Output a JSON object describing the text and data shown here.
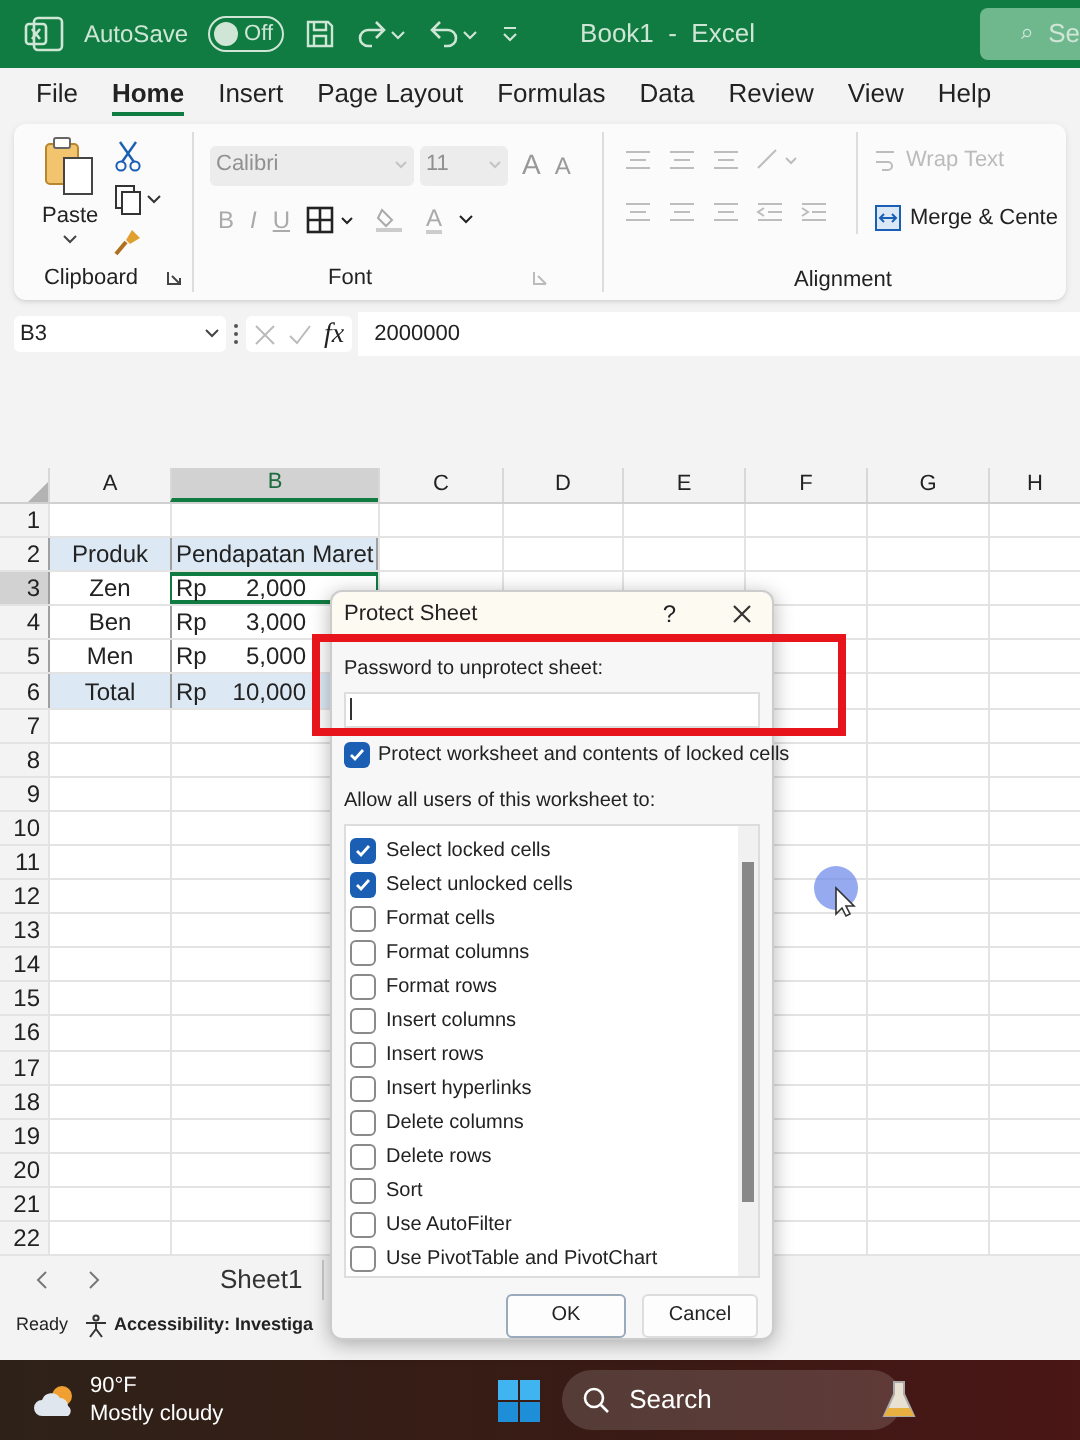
{
  "title_bar": {
    "autosave_label": "AutoSave",
    "autosave": {
      "on": false,
      "label": "Off"
    },
    "title": "Book1  -  Excel",
    "search_text": "Se"
  },
  "menu_tabs": [
    {
      "label": "File",
      "selected": false
    },
    {
      "label": "Home",
      "selected": true
    },
    {
      "label": "Insert",
      "selected": false
    },
    {
      "label": "Page Layout",
      "selected": false
    },
    {
      "label": "Formulas",
      "selected": false
    },
    {
      "label": "Data",
      "selected": false
    },
    {
      "label": "Review",
      "selected": false
    },
    {
      "label": "View",
      "selected": false
    },
    {
      "label": "Help",
      "selected": false
    }
  ],
  "ribbon": {
    "clipboard": {
      "paste_label": "Paste",
      "group_label": "Clipboard"
    },
    "font": {
      "font_name": "Calibri",
      "font_size": "11",
      "grow": "A",
      "shrink": "A",
      "bold": "B",
      "italic": "I",
      "underline": "U",
      "color_letter": "A",
      "group_label": "Font"
    },
    "alignment": {
      "wrap_text": "Wrap Text",
      "merge": "Merge & Cente",
      "group_label": "Alignment"
    }
  },
  "formula_bar": {
    "name_box": "B3",
    "fx": "fx",
    "value": "2000000"
  },
  "sheet": {
    "columns": [
      {
        "label": "A",
        "selected": false
      },
      {
        "label": "B",
        "selected": true
      },
      {
        "label": "C",
        "selected": false
      },
      {
        "label": "D",
        "selected": false
      },
      {
        "label": "E",
        "selected": false
      },
      {
        "label": "F",
        "selected": false
      },
      {
        "label": "G",
        "selected": false
      },
      {
        "label": "H",
        "selected": false
      }
    ],
    "row_numbers": [
      "1",
      "2",
      "3",
      "4",
      "5",
      "6",
      "7",
      "8",
      "9",
      "10",
      "11",
      "12",
      "13",
      "14",
      "15",
      "16",
      "17",
      "18",
      "19",
      "20",
      "21",
      "22"
    ],
    "rows": [
      {
        "kind": "header",
        "product": "Produk",
        "amount": "Pendapatan Maret",
        "selected": false
      },
      {
        "kind": "data",
        "product": "Zen",
        "currency": "Rp",
        "amount": "2,000",
        "selected": true
      },
      {
        "kind": "data",
        "product": "Ben",
        "currency": "Rp",
        "amount": "3,000",
        "selected": false
      },
      {
        "kind": "data",
        "product": "Men",
        "currency": "Rp",
        "amount": "5,000",
        "selected": false
      },
      {
        "kind": "total",
        "product": "Total",
        "currency": "Rp",
        "amount": "10,000",
        "selected": false
      }
    ]
  },
  "sheet_tabs": [
    {
      "label": "Sheet1",
      "selected": true
    }
  ],
  "status_bar": {
    "state": "Ready",
    "accessibility": "Accessibility: Investiga"
  },
  "dialog": {
    "title": "Protect Sheet",
    "help": "?",
    "password_label": "Password to unprotect sheet:",
    "protect": {
      "label": "Protect worksheet and contents of locked cells",
      "checked": true
    },
    "allow_label": "Allow all users of this worksheet to:",
    "permissions": [
      {
        "label": "Select locked cells",
        "checked": true
      },
      {
        "label": "Select unlocked cells",
        "checked": true
      },
      {
        "label": "Format cells",
        "checked": false
      },
      {
        "label": "Format columns",
        "checked": false
      },
      {
        "label": "Format rows",
        "checked": false
      },
      {
        "label": "Insert columns",
        "checked": false
      },
      {
        "label": "Insert rows",
        "checked": false
      },
      {
        "label": "Insert hyperlinks",
        "checked": false
      },
      {
        "label": "Delete columns",
        "checked": false
      },
      {
        "label": "Delete rows",
        "checked": false
      },
      {
        "label": "Sort",
        "checked": false
      },
      {
        "label": "Use AutoFilter",
        "checked": false
      },
      {
        "label": "Use PivotTable and PivotChart",
        "checked": false
      }
    ],
    "ok": "OK",
    "cancel": "Cancel"
  },
  "taskbar": {
    "temperature": "90°F",
    "condition": "Mostly cloudy",
    "search": "Search"
  }
}
